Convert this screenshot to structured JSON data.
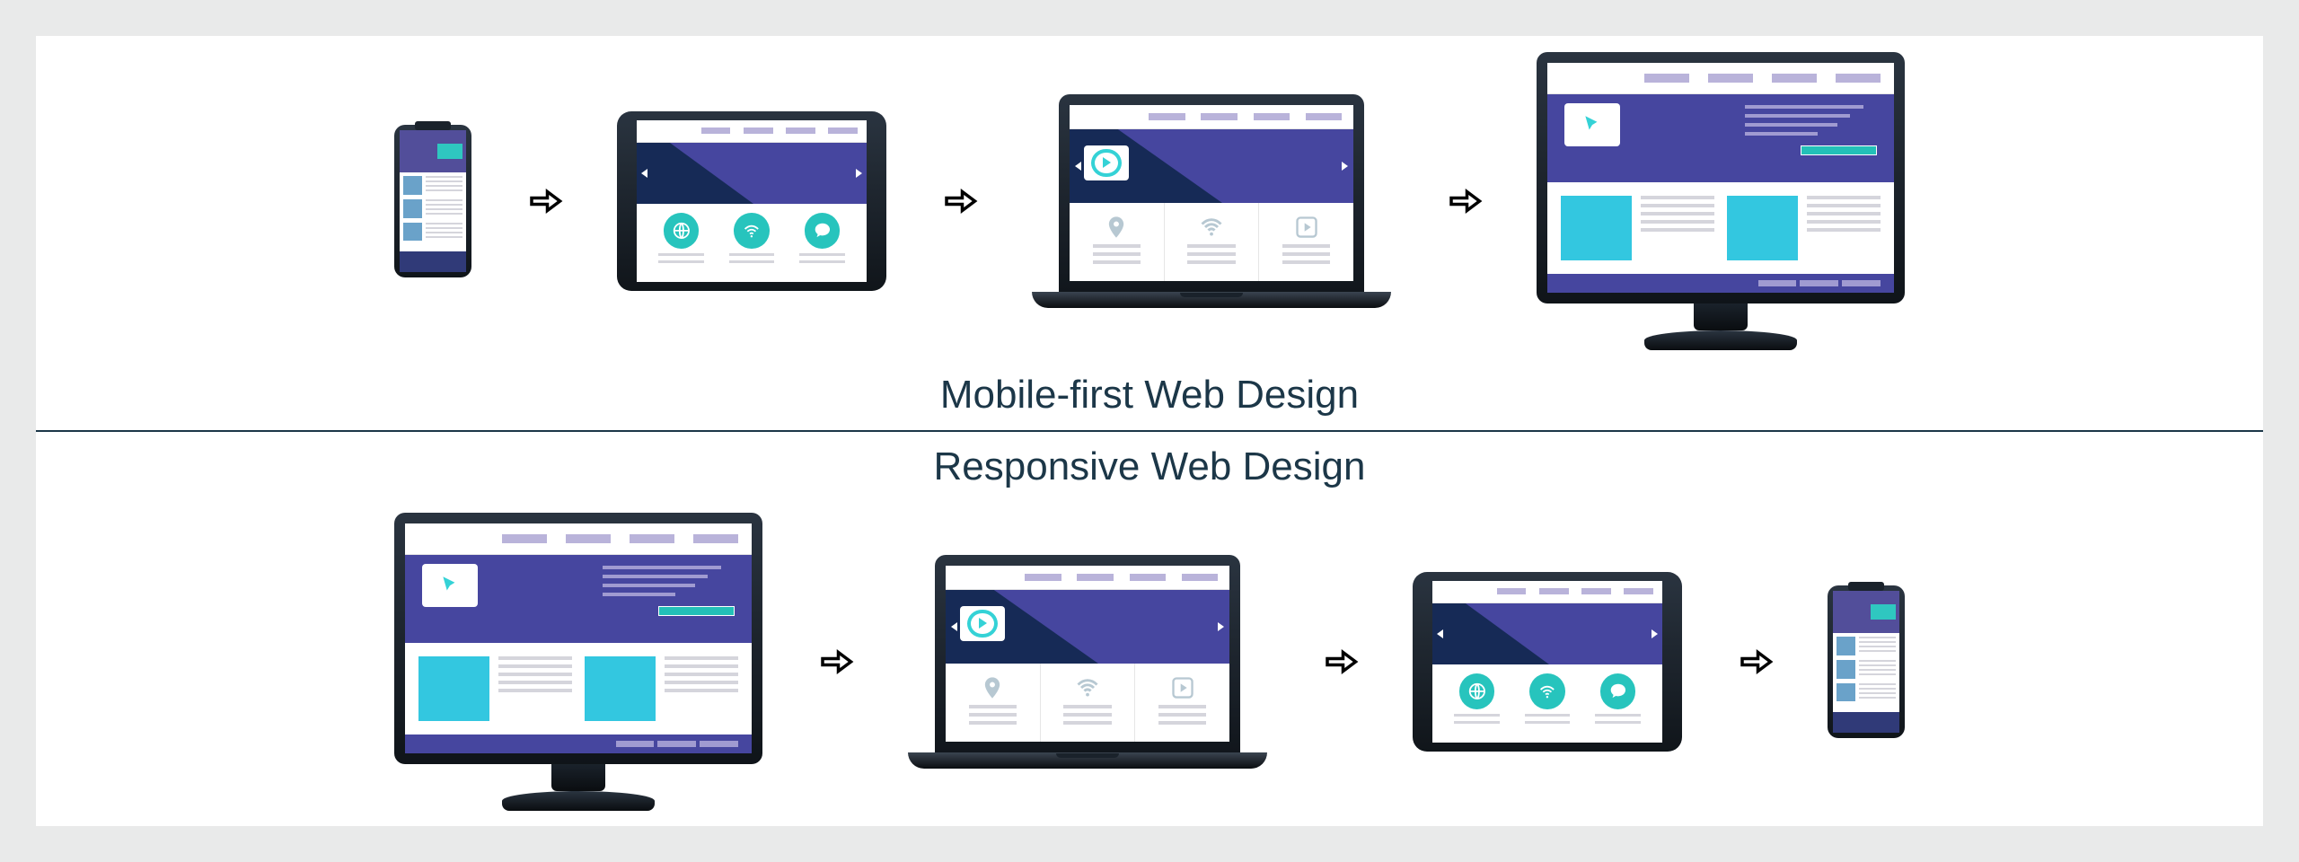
{
  "labels": {
    "top": "Mobile-first Web Design",
    "bottom": "Responsive Web Design"
  },
  "colors": {
    "text": "#1c3748",
    "hero": "#46469f",
    "accent_magenta": "#aa1f6e",
    "accent_navy": "#162a56",
    "teal": "#27c4bd",
    "cyan": "#33c7e0"
  },
  "sequences": {
    "mobile_first": [
      "phone",
      "tablet",
      "laptop",
      "desktop"
    ],
    "responsive": [
      "desktop",
      "laptop",
      "tablet",
      "phone"
    ]
  },
  "icons": {
    "arrow": "arrow-right-icon",
    "tablet_icons": [
      "globe-icon",
      "wifi-icon",
      "chat-icon"
    ],
    "laptop_icons": [
      "pin-icon",
      "wifi-icon",
      "play-icon"
    ],
    "monitor_badge": "cursor-badge-icon",
    "laptop_badge": "play-badge-icon"
  }
}
